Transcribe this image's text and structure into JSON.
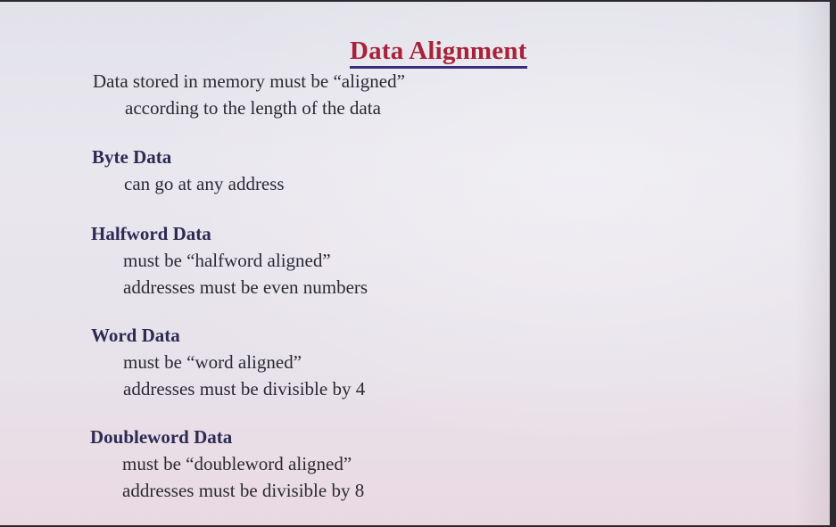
{
  "title": "Data Alignment",
  "intro": {
    "line1": "Data stored in memory must be “aligned”",
    "line2": "according to the length of the data"
  },
  "sections": [
    {
      "heading": "Byte Data",
      "lines": [
        "can go at any address"
      ]
    },
    {
      "heading": "Halfword Data",
      "lines": [
        "must be “halfword aligned”",
        "addresses must be even numbers"
      ]
    },
    {
      "heading": "Word Data",
      "lines": [
        "must be “word aligned”",
        "addresses must be divisible by 4"
      ]
    },
    {
      "heading": "Doubleword Data",
      "lines": [
        "must be “doubleword aligned”",
        "addresses must be divisible by 8"
      ]
    }
  ]
}
